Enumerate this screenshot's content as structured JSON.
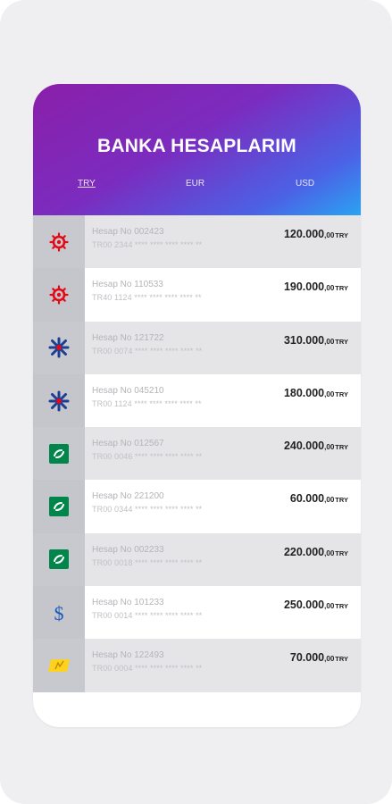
{
  "header": {
    "title": "BANKA HESAPLARIM",
    "tabs": [
      "TRY",
      "EUR",
      "USD"
    ],
    "active_tab": "TRY"
  },
  "accounts": [
    {
      "bank_icon": "ziraat-bank-icon",
      "account_no": "Hesap No 002423",
      "iban": "TR00 2344 **** **** **** **** **",
      "amount_int": "120.000",
      "amount_dec": ",00",
      "currency": "TRY"
    },
    {
      "bank_icon": "ziraat-bank-icon",
      "account_no": "Hesap No 110533",
      "iban": "TR40 1124 **** **** **** **** **",
      "amount_int": "190.000",
      "amount_dec": ",00",
      "currency": "TRY"
    },
    {
      "bank_icon": "isbank-icon",
      "account_no": "Hesap No 121722",
      "iban": "TR00 0074 **** **** **** **** **",
      "amount_int": "310.000",
      "amount_dec": ",00",
      "currency": "TRY"
    },
    {
      "bank_icon": "isbank-icon",
      "account_no": "Hesap No 045210",
      "iban": "TR00 1124 **** **** **** **** **",
      "amount_int": "180.000",
      "amount_dec": ",00",
      "currency": "TRY"
    },
    {
      "bank_icon": "garanti-bank-icon",
      "account_no": "Hesap No 012567",
      "iban": "TR00 0046 **** **** **** **** **",
      "amount_int": "240.000",
      "amount_dec": ",00",
      "currency": "TRY"
    },
    {
      "bank_icon": "garanti-bank-icon",
      "account_no": "Hesap No 221200",
      "iban": "TR00 0344 **** **** **** **** **",
      "amount_int": "60.000",
      "amount_dec": ",00",
      "currency": "TRY"
    },
    {
      "bank_icon": "garanti-bank-icon",
      "account_no": "Hesap No 002233",
      "iban": "TR00 0018 **** **** **** **** **",
      "amount_int": "220.000",
      "amount_dec": ",00",
      "currency": "TRY"
    },
    {
      "bank_icon": "dollar-bank-icon",
      "account_no": "Hesap No 101233",
      "iban": "TR00 0014 **** **** **** **** **",
      "amount_int": "250.000",
      "amount_dec": ",00",
      "currency": "TRY"
    },
    {
      "bank_icon": "yapikredi-bank-icon",
      "account_no": "Hesap No 122493",
      "iban": "TR00 0004 **** **** **** **** **",
      "amount_int": "70.000",
      "amount_dec": ",00",
      "currency": "TRY"
    }
  ],
  "colors": {
    "header_start": "#8a1fa9",
    "header_end": "#2aa3f2",
    "ziraat_red": "#e30a17",
    "isbank_blue": "#1c3f94",
    "garanti_green": "#00854a",
    "yapikredi_yellow": "#ffd21f"
  }
}
